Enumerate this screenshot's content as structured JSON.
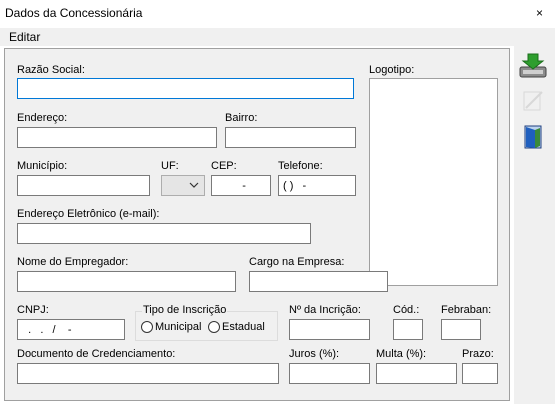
{
  "window": {
    "title": "Dados da Concessionária",
    "close_glyph": "×"
  },
  "menu": {
    "items": [
      "Editar"
    ]
  },
  "form": {
    "razao_social": {
      "label": "Razão Social:",
      "value": ""
    },
    "logotipo": {
      "label": "Logotipo:"
    },
    "endereco": {
      "label": "Endereço:",
      "value": ""
    },
    "bairro": {
      "label": "Bairro:",
      "value": ""
    },
    "municipio": {
      "label": "Município:",
      "value": ""
    },
    "uf": {
      "label": "UF:",
      "value": ""
    },
    "cep": {
      "label": "CEP:",
      "value": "  -"
    },
    "telefone": {
      "label": "Telefone:",
      "value": "( )   -"
    },
    "email": {
      "label": "Endereço Eletrônico (e-mail):",
      "value": ""
    },
    "empregador": {
      "label": "Nome do Empregador:",
      "value": ""
    },
    "cargo": {
      "label": "Cargo na Empresa:",
      "value": ""
    },
    "cnpj": {
      "label": "CNPJ:",
      "value": "  .   .   /    -"
    },
    "tipo_inscricao": {
      "label": "Tipo de Inscrição",
      "options": [
        "Municipal",
        "Estadual"
      ]
    },
    "num_inscricao": {
      "label": "Nº da Incrição:",
      "value": ""
    },
    "cod": {
      "label": "Cód.:",
      "value": ""
    },
    "febraban": {
      "label": "Febraban:",
      "value": ""
    },
    "documento": {
      "label": "Documento de Credenciamento:",
      "value": ""
    },
    "juros": {
      "label": "Juros (%):",
      "value": ""
    },
    "multa": {
      "label": "Multa (%):",
      "value": ""
    },
    "prazo": {
      "label": "Prazo:",
      "value": ""
    }
  },
  "toolbar": {
    "icons": [
      "save-disk-icon",
      "edit-disabled-icon",
      "exit-door-icon"
    ]
  },
  "colors": {
    "accent": "#0078d7",
    "save_arrow": "#2e9e2e",
    "door": "#1f5fbf"
  }
}
